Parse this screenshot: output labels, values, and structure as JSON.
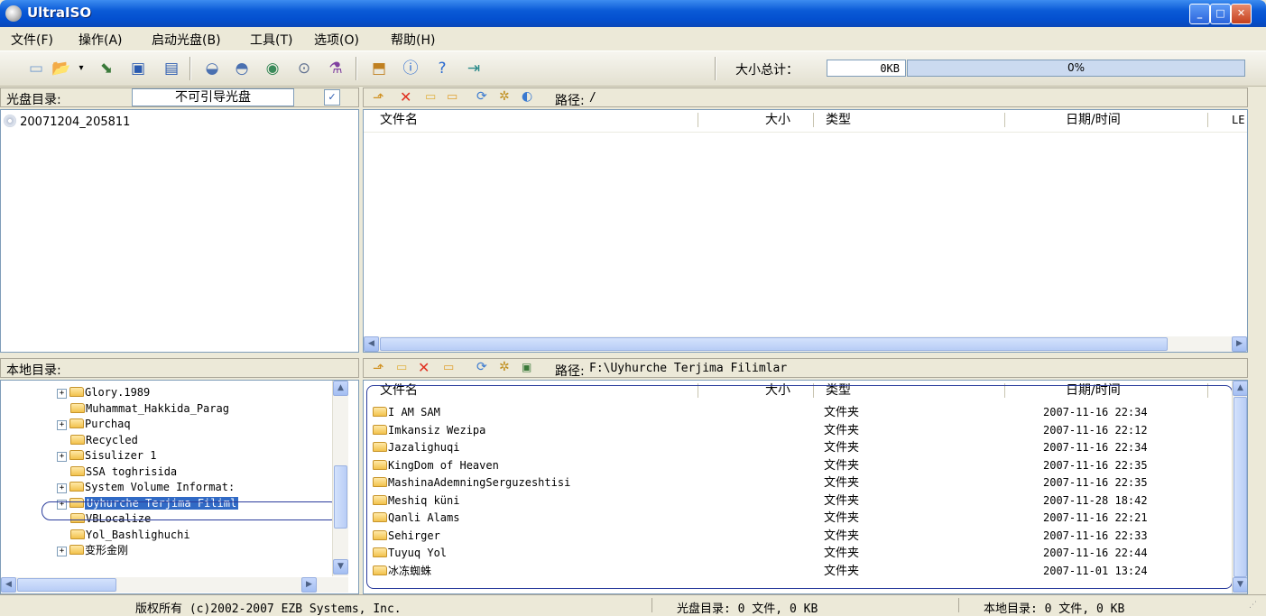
{
  "window": {
    "title": "UltraISO"
  },
  "menu": [
    "文件(F)",
    "操作(A)",
    "启动光盘(B)",
    "工具(T)",
    "选项(O)",
    "帮助(H)"
  ],
  "toolbar": {
    "size_label": "大小总计：",
    "size_value": "0KB",
    "progress_text": "0%",
    "progress_value": 0,
    "icons": [
      "new-icon",
      "open-icon",
      "dropdown-arrow-icon",
      "extract-icon",
      "save-icon",
      "save-as-icon",
      "mount-icon",
      "unmount-icon",
      "burn-icon",
      "virtual-drive-icon",
      "compress-icon",
      "properties-icon",
      "info-icon",
      "help-icon",
      "exit-icon"
    ]
  },
  "image_bar": {
    "label": "光盘目录:",
    "boot_value": "不可引导光盘",
    "path_label": "路径:",
    "path_value": "/"
  },
  "image_tree": {
    "root": "20071204_205811"
  },
  "image_list": {
    "columns": [
      "文件名",
      "大小",
      "类型",
      "日期/时间",
      "LE"
    ]
  },
  "local_bar": {
    "label": "本地目录:",
    "path_label": "路径:",
    "path_value": "F:\\Uyhurche Terjima Filimlar"
  },
  "local_tree": {
    "items": [
      {
        "label": "Glory.1989",
        "expand": true,
        "selected": false
      },
      {
        "label": "Muhammat_Hakkida_Parag",
        "expand": false,
        "selected": false
      },
      {
        "label": "Purchaq",
        "expand": true,
        "selected": false
      },
      {
        "label": "Recycled",
        "expand": false,
        "selected": false
      },
      {
        "label": "Sisulizer 1",
        "expand": true,
        "selected": false
      },
      {
        "label": "SSA toghrisida",
        "expand": false,
        "selected": false
      },
      {
        "label": "System Volume Informat:",
        "expand": true,
        "selected": false
      },
      {
        "label": "Uyhurche Terjima Filiml",
        "expand": true,
        "selected": true
      },
      {
        "label": "VBLocalize",
        "expand": false,
        "selected": false
      },
      {
        "label": "Yol_Bashlighuchi",
        "expand": false,
        "selected": false
      },
      {
        "label": "变形金刚",
        "expand": true,
        "selected": false
      }
    ]
  },
  "local_list": {
    "columns": [
      "文件名",
      "大小",
      "类型",
      "日期/时间"
    ],
    "rows": [
      {
        "name": "I AM SAM",
        "type": "文件夹",
        "date": "2007-11-16 22:34"
      },
      {
        "name": "Imkansiz Wezipa",
        "type": "文件夹",
        "date": "2007-11-16 22:12"
      },
      {
        "name": "Jazalighuqi",
        "type": "文件夹",
        "date": "2007-11-16 22:34"
      },
      {
        "name": "KingDom of Heaven",
        "type": "文件夹",
        "date": "2007-11-16 22:35"
      },
      {
        "name": "MashinaAdemningSerguzeshtisi",
        "type": "文件夹",
        "date": "2007-11-16 22:35"
      },
      {
        "name": "Meshiq küni",
        "type": "文件夹",
        "date": "2007-11-28 18:42"
      },
      {
        "name": "Qanli Alams",
        "type": "文件夹",
        "date": "2007-11-16 22:21"
      },
      {
        "name": "Sehirger",
        "type": "文件夹",
        "date": "2007-11-16 22:33"
      },
      {
        "name": "Tuyuq Yol",
        "type": "文件夹",
        "date": "2007-11-16 22:44"
      },
      {
        "name": "冰冻蜘蛛",
        "type": "文件夹",
        "date": "2007-11-01 13:24"
      }
    ]
  },
  "status": {
    "copyright": "版权所有 (c)2002-2007 EZB Systems, Inc.",
    "image_info": "光盘目录: 0 文件, 0 KB",
    "local_info": "本地目录: 0 文件, 0 KB"
  },
  "colors": {
    "title_bar": "#0a5ad6",
    "selection_outline": "#2a3c9c",
    "folder": "#f2c24c"
  }
}
